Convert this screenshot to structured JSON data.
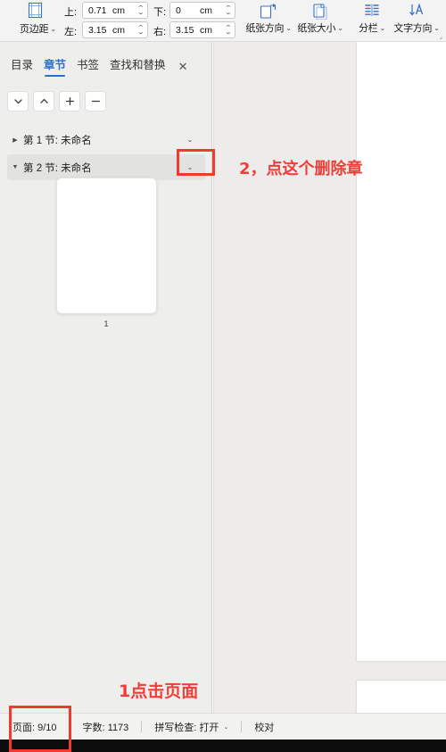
{
  "ribbon": {
    "margin_button": {
      "label": "页边距",
      "icon": "page-margins-icon",
      "caret": "⌄"
    },
    "fields": [
      {
        "label": "上:",
        "value": "0.71",
        "unit": "cm"
      },
      {
        "label": "下:",
        "value": "0",
        "unit": "cm"
      },
      {
        "label": "左:",
        "value": "3.15",
        "unit": "cm"
      },
      {
        "label": "右:",
        "value": "3.15",
        "unit": "cm"
      }
    ],
    "buttons": [
      {
        "label": "纸张方向",
        "icon": "page-orientation-icon",
        "caret": "⌄"
      },
      {
        "label": "纸张大小",
        "icon": "page-size-icon",
        "caret": "⌄"
      },
      {
        "label": "分栏",
        "icon": "columns-icon",
        "caret": "⌄"
      },
      {
        "label": "文字方向",
        "icon": "text-direction-icon",
        "caret": "⌄"
      }
    ],
    "expander": "⌟"
  },
  "nav": {
    "tabs": [
      {
        "label": "目录",
        "active": false
      },
      {
        "label": "章节",
        "active": true
      },
      {
        "label": "书签",
        "active": false
      },
      {
        "label": "查找和替换",
        "active": false
      }
    ],
    "close_label": "✕",
    "toolbar": [
      {
        "name": "move-down-button",
        "glyph": "⌄"
      },
      {
        "name": "move-up-button",
        "glyph": "⌃"
      },
      {
        "name": "add-section-button",
        "glyph": "＋"
      },
      {
        "name": "remove-section-button",
        "glyph": "－"
      }
    ],
    "tree": [
      {
        "label": "第 1 节: 未命名",
        "twisty": "▶",
        "expanded": false,
        "selected": false,
        "chevron": "⌄"
      },
      {
        "label": "第 2 节: 未命名",
        "twisty": "▼",
        "expanded": true,
        "selected": true,
        "chevron": "⌄"
      }
    ],
    "thumbnail": {
      "page_number": "1"
    }
  },
  "status": {
    "page_label": "页面: 9/10",
    "words_label": "字数: 1173",
    "spellcheck_label": "拼写检查: 打开",
    "spellcheck_caret": "⌄",
    "proof_label": "校对"
  },
  "annotations": [
    {
      "id": "note-delete-section",
      "text": "2，点这个删除章"
    },
    {
      "id": "note-click-page",
      "text": "1点击页面"
    }
  ],
  "colors": {
    "accent": "#2c6fd4",
    "annotation": "#ef3e37",
    "panel_bg": "#eeeeec",
    "doc_bg": "#edecea",
    "status_bg": "#f2f2f0"
  }
}
